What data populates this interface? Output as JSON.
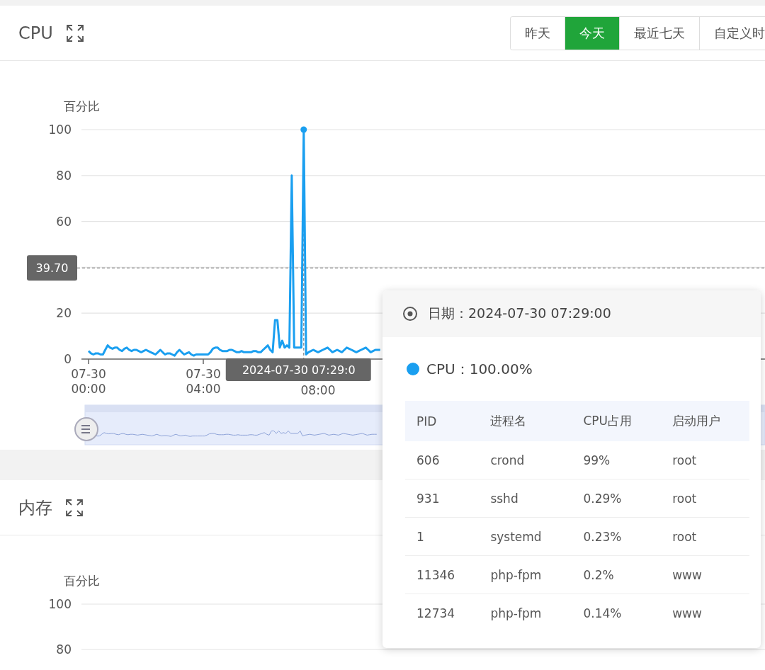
{
  "cpu": {
    "title": "CPU",
    "ranges": [
      {
        "label": "昨天",
        "selected": false
      },
      {
        "label": "今天",
        "selected": true
      },
      {
        "label": "最近七天",
        "selected": false
      },
      {
        "label": "自定义时",
        "selected": false
      }
    ],
    "pointers": {
      "x_label": "2024-07-30 07:29:0"
    },
    "chart_data": {
      "type": "line",
      "ylabel": "百分比",
      "ylim": [
        0,
        100
      ],
      "yticks": [
        0,
        20,
        60,
        80,
        100
      ],
      "grid": true,
      "ref_lines": [
        {
          "axis": "y",
          "value": 39.7,
          "label": "39.70"
        }
      ],
      "categories": [
        "07-30 00:00",
        null,
        null,
        null,
        null,
        null,
        null,
        null,
        null,
        null,
        null,
        null,
        null,
        null,
        null,
        null,
        null,
        null,
        null,
        null,
        null,
        null,
        null,
        null,
        null,
        null,
        null,
        null,
        null,
        null,
        null,
        null,
        null,
        null,
        null,
        null,
        null,
        null,
        null,
        null,
        null,
        null,
        null,
        null,
        null,
        null,
        null,
        null,
        "07-30 04:00",
        null,
        null,
        null,
        null,
        null,
        null,
        null,
        null,
        null,
        null,
        null,
        null,
        null,
        null,
        null,
        null,
        null,
        null,
        null,
        null,
        null,
        null,
        null,
        null,
        null,
        null,
        null,
        null,
        null,
        null,
        null,
        null,
        null,
        null,
        null,
        null,
        null,
        null,
        null,
        null,
        null,
        null,
        null,
        null,
        null,
        null,
        null,
        "08:00",
        null,
        null,
        null,
        null,
        null,
        null,
        null,
        null,
        null,
        null,
        null,
        null,
        null,
        null,
        null,
        null,
        null,
        null,
        null,
        null,
        null,
        null,
        null,
        null,
        null,
        null
      ],
      "series": [
        {
          "color": "#1a9ff0",
          "values": [
            3.5,
            2.5,
            2,
            2.5,
            2.5,
            2,
            2,
            4,
            6,
            5,
            4.5,
            5,
            5,
            4,
            3.5,
            4.5,
            5,
            4,
            3.5,
            4,
            4,
            3.5,
            3,
            3.5,
            4,
            3.5,
            3,
            2.5,
            2,
            3,
            4,
            3,
            2,
            2.5,
            2.5,
            2,
            1.5,
            3,
            4,
            3,
            2,
            2.5,
            3,
            2,
            1.5,
            2,
            2,
            2,
            2,
            2,
            2,
            3,
            4.5,
            5,
            5,
            4,
            3.5,
            3.5,
            3.5,
            4,
            4,
            3.5,
            3,
            3,
            3.5,
            3,
            3,
            3,
            3,
            3.5,
            3.5,
            3,
            3,
            4,
            5,
            6,
            4,
            3,
            17,
            17,
            5,
            8,
            5,
            6,
            5,
            80,
            5,
            5,
            5,
            5,
            100,
            2,
            3,
            3.5,
            4,
            3.5,
            3,
            3.5,
            4,
            4.5,
            5,
            4,
            3,
            3.5,
            4,
            3.5,
            3,
            4,
            5,
            4.5,
            4,
            3.5,
            3,
            3.5,
            4,
            4.5,
            5,
            4,
            3,
            3.5,
            4,
            4,
            4
          ]
        }
      ]
    }
  },
  "tooltip": {
    "date_label": "日期：2024-07-30 07:29:00",
    "series": {
      "label": "CPU：100.00%",
      "color": "#1a9ff0"
    },
    "columns": [
      "PID",
      "进程名",
      "CPU占用",
      "启动用户"
    ],
    "rows": [
      [
        "606",
        "crond",
        "99%",
        "root"
      ],
      [
        "931",
        "sshd",
        "0.29%",
        "root"
      ],
      [
        "1",
        "systemd",
        "0.23%",
        "root"
      ],
      [
        "11346",
        "php-fpm",
        "0.2%",
        "www"
      ],
      [
        "12734",
        "php-fpm",
        "0.14%",
        "www"
      ]
    ]
  },
  "memory": {
    "title": "内存",
    "y_axis_title": "百分比",
    "y_tick_labels": [
      "100",
      "80"
    ]
  }
}
